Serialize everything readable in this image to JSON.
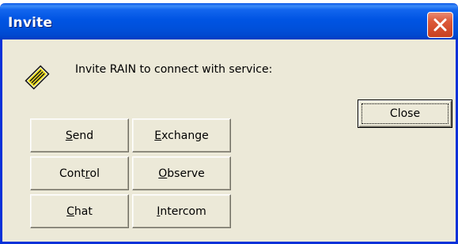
{
  "window": {
    "title": "Invite"
  },
  "message": "Invite RAIN to connect with service:",
  "icon": {
    "name": "invite-envelope-icon",
    "accent": "#f5e21d"
  },
  "buttons": {
    "close": {
      "label": "Close"
    },
    "send": {
      "pre": "",
      "u": "S",
      "post": "end"
    },
    "exchange": {
      "pre": "",
      "u": "E",
      "post": "xchange"
    },
    "control": {
      "pre": "Cont",
      "u": "r",
      "post": "ol"
    },
    "observe": {
      "pre": "",
      "u": "O",
      "post": "bserve"
    },
    "chat": {
      "pre": "",
      "u": "C",
      "post": "hat"
    },
    "intercom": {
      "pre": "",
      "u": "I",
      "post": "ntercom"
    }
  },
  "colors": {
    "titlebar": "#0054e3",
    "close_x": "#dd5a3a",
    "face": "#ece9d8"
  }
}
